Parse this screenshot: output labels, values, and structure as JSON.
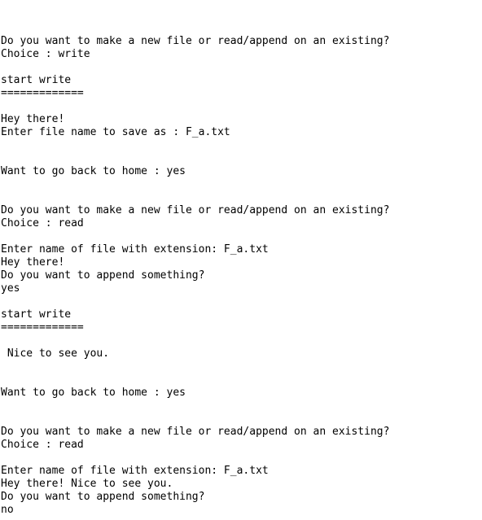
{
  "console": {
    "lines": [
      "",
      "",
      "",
      "Do you want to make a new file or read/append on an existing?",
      "Choice : write",
      "",
      "start write",
      "=============",
      "",
      "Hey there!",
      "Enter file name to save as : F_a.txt",
      "",
      "",
      "Want to go back to home : yes",
      "",
      "",
      "Do you want to make a new file or read/append on an existing?",
      "Choice : read",
      "",
      "Enter name of file with extension: F_a.txt",
      "Hey there!",
      "Do you want to append something?",
      "yes",
      "",
      "start write",
      "=============",
      "",
      " Nice to see you.",
      "",
      "",
      "Want to go back to home : yes",
      "",
      "",
      "Do you want to make a new file or read/append on an existing?",
      "Choice : read",
      "",
      "Enter name of file with extension: F_a.txt",
      "Hey there! Nice to see you.",
      "Do you want to append something?",
      "no"
    ]
  }
}
